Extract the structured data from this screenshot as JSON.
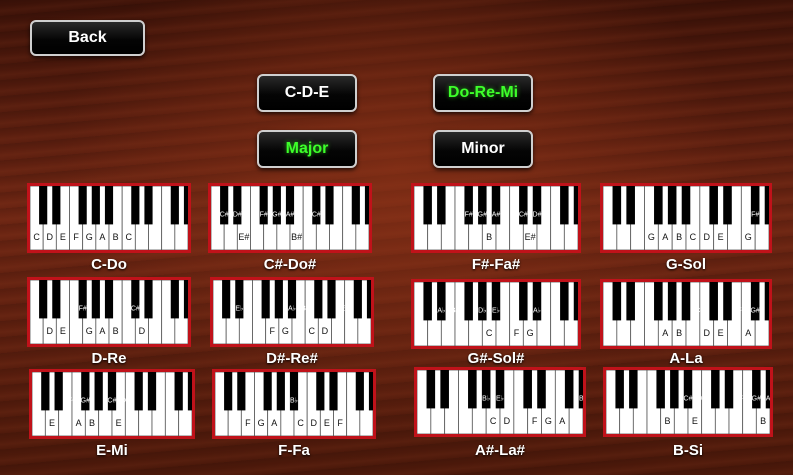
{
  "back_label": "Back",
  "notation_buttons": [
    {
      "label": "C-D-E",
      "active": false
    },
    {
      "label": "Do-Re-Mi",
      "active": true
    }
  ],
  "scale_buttons": [
    {
      "label": "Major",
      "active": true
    },
    {
      "label": "Minor",
      "active": false
    }
  ],
  "keyboards": [
    {
      "name": "C-Do",
      "white_labels": [
        "C",
        "D",
        "E",
        "F",
        "G",
        "A",
        "B",
        "C",
        "",
        "",
        "",
        ""
      ],
      "black_labels": []
    },
    {
      "name": "C#-Do#",
      "white_labels": [
        "",
        "",
        "E#",
        "",
        "",
        "",
        "B#",
        "",
        "",
        "",
        "",
        ""
      ],
      "black_labels": [
        {
          "w": 0,
          "t": "C#"
        },
        {
          "w": 1,
          "t": "D#"
        },
        {
          "w": 3,
          "t": "F#"
        },
        {
          "w": 4,
          "t": "G#"
        },
        {
          "w": 5,
          "t": "A#"
        },
        {
          "w": 7,
          "t": "C#"
        }
      ]
    },
    {
      "name": "F#-Fa#",
      "white_labels": [
        "",
        "",
        "",
        "",
        "",
        "B",
        "",
        "",
        "E#",
        "",
        "",
        ""
      ],
      "black_labels": [
        {
          "w": 3,
          "t": "F#"
        },
        {
          "w": 4,
          "t": "G#"
        },
        {
          "w": 5,
          "t": "A#"
        },
        {
          "w": 7,
          "t": "C#"
        },
        {
          "w": 8,
          "t": "D#"
        }
      ]
    },
    {
      "name": "G-Sol",
      "white_labels": [
        "",
        "",
        "",
        "G",
        "A",
        "B",
        "C",
        "D",
        "E",
        "",
        "G",
        ""
      ],
      "black_labels": [
        {
          "w": 10,
          "t": "F#"
        }
      ]
    },
    {
      "name": "D-Re",
      "white_labels": [
        "",
        "D",
        "E",
        "",
        "G",
        "A",
        "B",
        "",
        "D",
        "",
        "",
        ""
      ],
      "black_labels": [
        {
          "w": 3,
          "t": "F#"
        },
        {
          "w": 7,
          "t": "C#"
        }
      ]
    },
    {
      "name": "D#-Re#",
      "white_labels": [
        "",
        "",
        "",
        "",
        "F",
        "G",
        "",
        "C",
        "D",
        "",
        "",
        ""
      ],
      "black_labels": [
        {
          "w": 1,
          "t": "E♭"
        },
        {
          "w": 5,
          "t": "A♭"
        },
        {
          "w": 6,
          "t": "B♭"
        },
        {
          "w": 9,
          "t": "E♭"
        }
      ]
    },
    {
      "name": "G#-Sol#",
      "white_labels": [
        "",
        "",
        "",
        "",
        "",
        "C",
        "",
        "F",
        "G",
        "",
        "",
        ""
      ],
      "black_labels": [
        {
          "w": 1,
          "t": "A♭"
        },
        {
          "w": 2,
          "t": "B♭"
        },
        {
          "w": 4,
          "t": "D♭"
        },
        {
          "w": 5,
          "t": "E♭"
        },
        {
          "w": 8,
          "t": "A♭"
        }
      ]
    },
    {
      "name": "A-La",
      "white_labels": [
        "",
        "",
        "",
        "",
        "A",
        "B",
        "",
        "D",
        "E",
        "",
        "A",
        ""
      ],
      "black_labels": [
        {
          "w": 6,
          "t": "C#"
        },
        {
          "w": 9,
          "t": "F#"
        },
        {
          "w": 10,
          "t": "G#"
        }
      ]
    },
    {
      "name": "E-Mi",
      "white_labels": [
        "",
        "E",
        "",
        "A",
        "B",
        "",
        "E",
        "",
        "",
        "",
        "",
        ""
      ],
      "black_labels": [
        {
          "w": 2,
          "t": "F#"
        },
        {
          "w": 3,
          "t": "G#"
        },
        {
          "w": 5,
          "t": "C#"
        },
        {
          "w": 6,
          "t": "D#"
        }
      ]
    },
    {
      "name": "F-Fa",
      "white_labels": [
        "",
        "",
        "F",
        "G",
        "A",
        "",
        "C",
        "D",
        "E",
        "F",
        "",
        ""
      ],
      "black_labels": [
        {
          "w": 5,
          "t": "B♭"
        }
      ]
    },
    {
      "name": "A#-La#",
      "white_labels": [
        "",
        "",
        "",
        "",
        "",
        "C",
        "D",
        "",
        "F",
        "G",
        "A",
        ""
      ],
      "black_labels": [
        {
          "w": 4,
          "t": "B♭"
        },
        {
          "w": 5,
          "t": "E♭"
        },
        {
          "w": 11,
          "t": "B♭"
        }
      ]
    },
    {
      "name": "B-Si",
      "white_labels": [
        "",
        "",
        "",
        "",
        "B",
        "",
        "E",
        "",
        "",
        "",
        "",
        "B"
      ],
      "black_labels": [
        {
          "w": 5,
          "t": "C#"
        },
        {
          "w": 6,
          "t": "D#"
        },
        {
          "w": 9,
          "t": "F#"
        },
        {
          "w": 10,
          "t": "G#"
        },
        {
          "w": 11,
          "t": "A#"
        }
      ]
    }
  ]
}
